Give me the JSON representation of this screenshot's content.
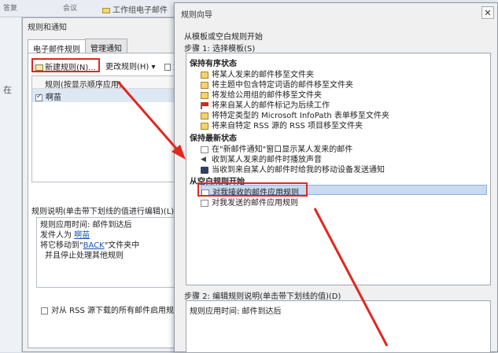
{
  "background": {
    "reply_button": "答复",
    "meeting_button": "会议",
    "folder_label": "工作组电子邮件",
    "side_label": "在"
  },
  "rules_dialog": {
    "title": "规则和通知",
    "tabs": [
      "电子邮件规则",
      "管理通知"
    ],
    "toolbar": {
      "new_rule": "新建规则(N)...",
      "change_rule": "更改规则(H) ▾",
      "copy": "复"
    },
    "list_header": "规则(按显示顺序应用)",
    "rules": [
      {
        "name": "啊苗",
        "checked": true
      }
    ],
    "desc_label": "规则说明(单击带下划线的值进行编辑)(L):",
    "desc": {
      "line1": "规则应用时间: 邮件到达后",
      "line2_prefix": "发件人为 ",
      "line2_link": "啊苗",
      "line3_prefix": "将它移动到\"",
      "line3_link": "BACK",
      "line3_suffix": "\"文件夹中",
      "line4": "并且停止处理其他规则"
    },
    "rss_option": "对从 RSS 源下载的所有邮件启用规则(E)"
  },
  "wizard": {
    "title": "规则向导",
    "close": "✕",
    "heading": "从模板或空白规则开始",
    "step1": "步骤 1: 选择模板(S)",
    "groups": [
      {
        "name": "保持有序状态",
        "items": [
          {
            "label": "将某人发来的邮件移至文件夹",
            "icon": "folder-icon"
          },
          {
            "label": "将主题中包含特定词语的邮件移至文件夹",
            "icon": "folder-icon"
          },
          {
            "label": "将发给公用组的邮件移至文件夹",
            "icon": "folder-icon"
          },
          {
            "label": "将来自某人的邮件标记为后续工作",
            "icon": "flag-icon"
          },
          {
            "label": "将特定类型的 Microsoft InfoPath 表单移至文件夹",
            "icon": "folder-icon"
          },
          {
            "label": "将来自特定 RSS 源的 RSS 项目移至文件夹",
            "icon": "folder-icon"
          }
        ]
      },
      {
        "name": "保持最新状态",
        "items": [
          {
            "label": "在\"新邮件通知\"窗口显示某人发来的邮件",
            "icon": "mail-icon"
          },
          {
            "label": "收到某人发来的邮件时播放声音",
            "icon": "sound-icon"
          },
          {
            "label": "当收到来自某人的邮件时给我的移动设备发送通知",
            "icon": "phone-icon"
          }
        ]
      },
      {
        "name": "从空白规则开始",
        "items": [
          {
            "label": "对我接收的邮件应用规则",
            "icon": "mail-icon",
            "selected": true
          },
          {
            "label": "对我发送的邮件应用规则",
            "icon": "mail-icon"
          }
        ]
      }
    ],
    "step2": "步骤 2: 编辑规则说明(单击带下划线的值)(D)",
    "step2_desc": "规则应用时间: 邮件到达后"
  },
  "colors": {
    "annotation_red": "#e0281f",
    "selection": "#c9daf0"
  }
}
